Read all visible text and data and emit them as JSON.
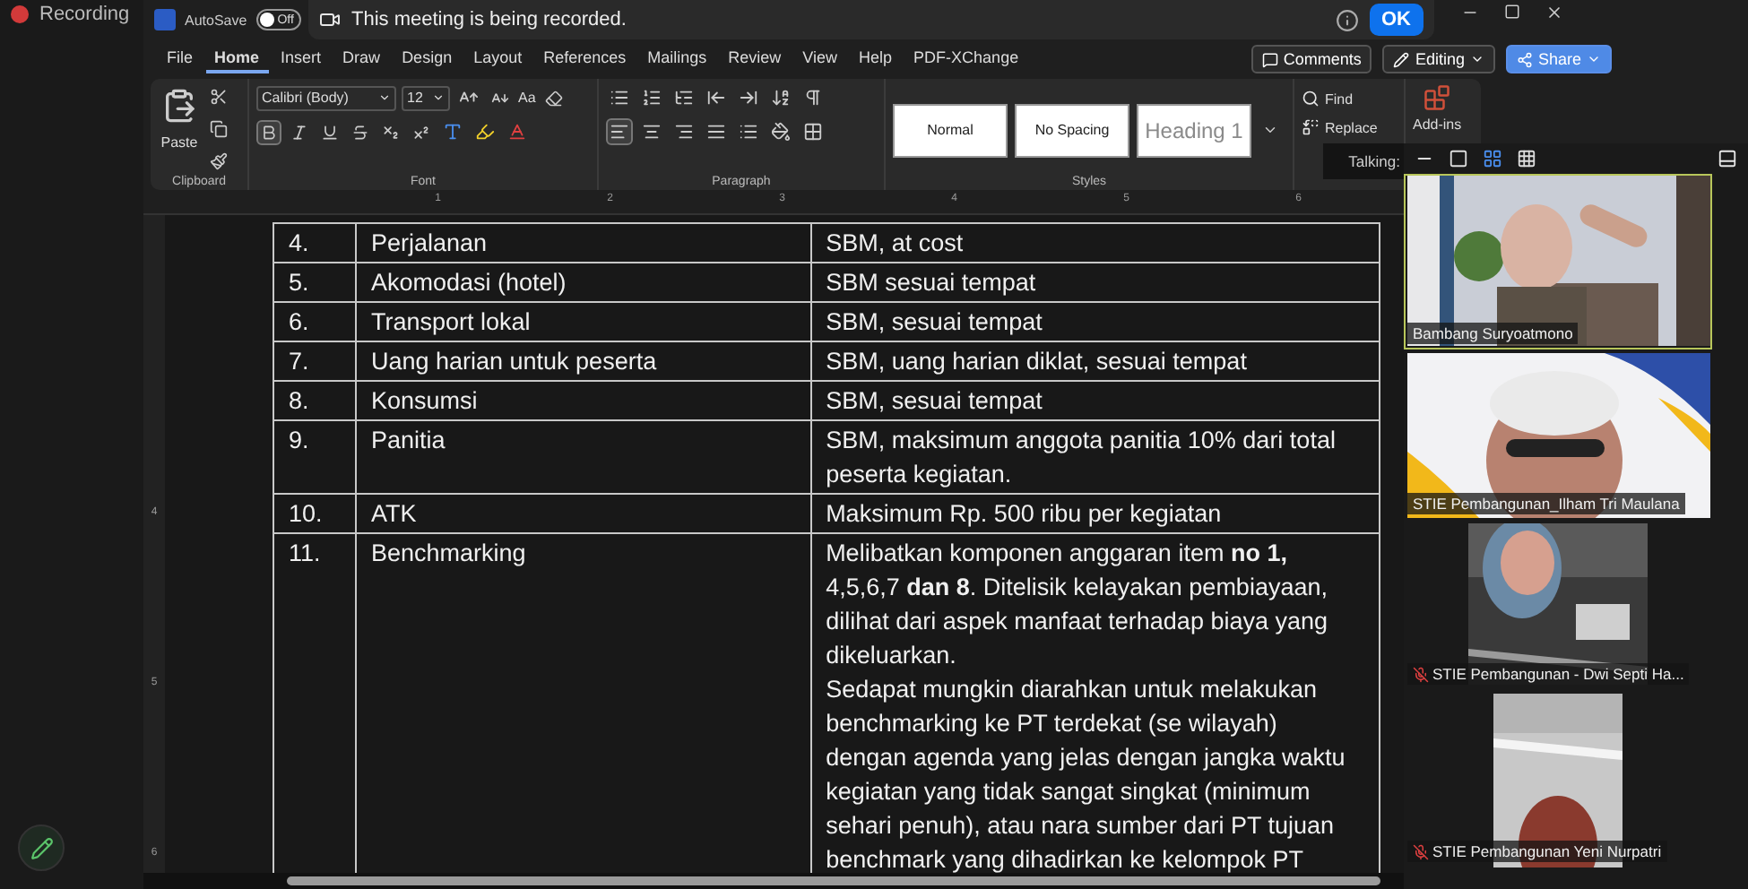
{
  "recording": {
    "label": "Recording"
  },
  "title_bar": {
    "autosave_label": "AutoSave",
    "autosave_on": false,
    "toggle_label": "Off"
  },
  "banner": {
    "text": "This meeting is being recorded.",
    "button": "OK"
  },
  "tabs": [
    {
      "label": "File",
      "selected": false
    },
    {
      "label": "Home",
      "selected": true
    },
    {
      "label": "Insert",
      "selected": false
    },
    {
      "label": "Draw",
      "selected": false
    },
    {
      "label": "Design",
      "selected": false
    },
    {
      "label": "Layout",
      "selected": false
    },
    {
      "label": "References",
      "selected": false
    },
    {
      "label": "Mailings",
      "selected": false
    },
    {
      "label": "Review",
      "selected": false
    },
    {
      "label": "View",
      "selected": false
    },
    {
      "label": "Help",
      "selected": false
    },
    {
      "label": "PDF-XChange",
      "selected": false
    }
  ],
  "actions": [
    {
      "kind": "comments",
      "label": "Comments"
    },
    {
      "kind": "editing",
      "label": "Editing"
    },
    {
      "kind": "share",
      "label": "Share"
    }
  ],
  "ribbon": {
    "paste": "Paste",
    "font_name": "Calibri (Body)",
    "font_size": "12",
    "change_case": "Aa",
    "bold_on": true,
    "alignments": [
      {
        "kind": "left",
        "selected": true
      },
      {
        "kind": "center",
        "selected": false
      },
      {
        "kind": "right",
        "selected": false
      },
      {
        "kind": "justify",
        "selected": false
      }
    ],
    "styles": [
      {
        "kind": "body",
        "label": "Normal"
      },
      {
        "kind": "body",
        "label": "No Spacing"
      },
      {
        "kind": "heading",
        "label": "Heading 1"
      }
    ],
    "find": "Find",
    "replace": "Replace",
    "addins": "Add-ins",
    "groups": [
      "Clipboard",
      "Font",
      "Paragraph",
      "Styles"
    ]
  },
  "ruler": {
    "marks": [
      "1",
      "2",
      "3",
      "4",
      "5",
      "6"
    ],
    "side_marks": [
      "4",
      "5",
      "6"
    ]
  },
  "table": {
    "rows": [
      {
        "number": "4.",
        "item": "Perjalanan",
        "description": "SBM, at cost"
      },
      {
        "number": "5.",
        "item": "Akomodasi (hotel)",
        "description": "SBM sesuai tempat"
      },
      {
        "number": "6.",
        "item": "Transport lokal",
        "description": "SBM, sesuai tempat"
      },
      {
        "number": "7.",
        "item": "Uang harian untuk peserta",
        "description": "SBM, uang harian diklat, sesuai tempat"
      },
      {
        "number": "8.",
        "item": "Konsumsi",
        "description": "SBM, sesuai tempat"
      },
      {
        "number": "9.",
        "item": "Panitia",
        "description": "SBM, maksimum anggota panitia 10% dari total peserta kegiatan."
      },
      {
        "number": "10.",
        "item": "ATK",
        "description": "Maksimum Rp. 500 ribu per kegiatan"
      },
      {
        "number": "11.",
        "item": "Benchmarking",
        "description": "Melibatkan komponen anggaran item **no 1,** 4,5,6,7 **dan 8**. Ditelisik kelayakan pembiayaan, dilihat dari aspek manfaat terhadap biaya yang dikeluarkan.",
        "description_2": "Sedapat mungkin diarahkan untuk melakukan benchmarking ke PT terdekat (se wilayah) dengan agenda yang jelas dengan jangka waktu kegiatan yang tidak sangat singkat (minimum sehari penuh), atau nara sumber dari PT tujuan benchmark yang dihadirkan ke kelompok PT"
      }
    ]
  },
  "talking": "Talking:",
  "view_modes": [
    {
      "kind": "minimize",
      "selected": false
    },
    {
      "kind": "strip",
      "selected": false
    },
    {
      "kind": "gallery",
      "selected": true
    },
    {
      "kind": "grid",
      "selected": false
    }
  ],
  "tiles": [
    {
      "name": "Bambang Suryoatmono",
      "muted": false,
      "active": true,
      "kind": "room"
    },
    {
      "name": "STIE Pembangunan_Ilham Tri Maulana",
      "muted": false,
      "active": false,
      "kind": "banner"
    },
    {
      "name": "STIE Pembangunan - Dwi Septi Ha...",
      "muted": true,
      "active": false,
      "kind": "ceiling"
    },
    {
      "name": "STIE Pembangunan Yeni Nurpatri",
      "muted": true,
      "active": false,
      "kind": "wall"
    }
  ]
}
